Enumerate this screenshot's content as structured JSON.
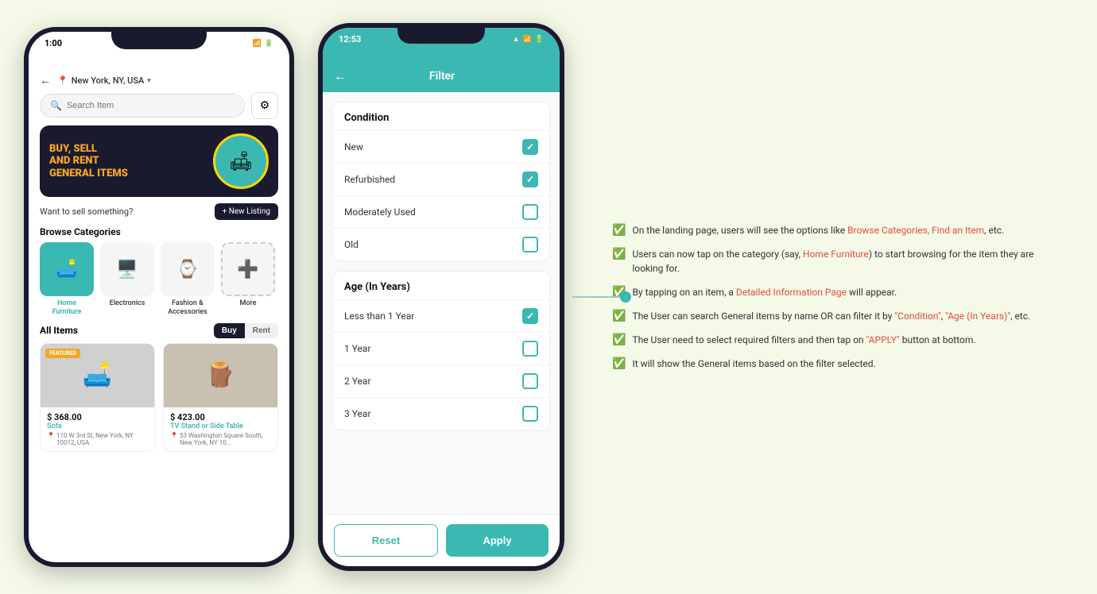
{
  "background": "#f4f9e8",
  "phone1": {
    "status_time": "1:00",
    "location": "New York, NY, USA",
    "search_placeholder": "Search Item",
    "banner": {
      "line1": "BUY, SELL",
      "line2": "AND RENT",
      "line3": "GENERAL ITEMS"
    },
    "sell_text": "Want to sell something?",
    "new_listing_label": "+ New Listing",
    "browse_title": "Browse Categories",
    "categories": [
      {
        "label": "Home\nFurniture",
        "icon": "🛋️",
        "active": true
      },
      {
        "label": "Electronics",
        "icon": "🖥️",
        "active": false
      },
      {
        "label": "Fashion &\nAccessories",
        "icon": "⌚",
        "active": false
      },
      {
        "label": "More",
        "icon": "➕",
        "active": false
      }
    ],
    "all_items_title": "All Items",
    "buy_label": "Buy",
    "rent_label": "Rent",
    "products": [
      {
        "price": "$ 368.00",
        "name": "Sofa",
        "location": "110 W 3rd St, New York, NY 10012, USA",
        "featured": true,
        "icon": "🛋️"
      },
      {
        "price": "$ 423.00",
        "name": "TV Stand or Side Table",
        "location": "53 Washington Square South, New York, NY 10...",
        "featured": false,
        "icon": "🪵"
      }
    ]
  },
  "phone2": {
    "status_time": "12:53",
    "title": "Filter",
    "back_label": "←",
    "condition_title": "Condition",
    "condition_items": [
      {
        "label": "New",
        "checked": true
      },
      {
        "label": "Refurbished",
        "checked": true
      },
      {
        "label": "Moderately Used",
        "checked": false
      },
      {
        "label": "Old",
        "checked": false
      }
    ],
    "age_title": "Age (In Years)",
    "age_items": [
      {
        "label": "Less than 1 Year",
        "checked": true
      },
      {
        "label": "1 Year",
        "checked": false
      },
      {
        "label": "2 Year",
        "checked": false
      },
      {
        "label": "3 Year",
        "checked": false
      }
    ],
    "reset_label": "Reset",
    "apply_label": "Apply"
  },
  "annotations": [
    {
      "text": "On the landing page, users will see the options like Browse Categories, Find an Item, etc."
    },
    {
      "text": "Users can now tap on the category (say, Home Furniture) to start browsing for the item they are looking for."
    },
    {
      "text": "By tapping on an item, a Detailed Information Page will appear."
    },
    {
      "text": "The User can search General items by name OR can filter it by \"Condition\", \"Age (In Years)\", etc."
    },
    {
      "text": "The User need to select required filters and then tap on \"APPLY\" button at bottom."
    },
    {
      "text": "It will show the General items based on the filter selected."
    }
  ]
}
